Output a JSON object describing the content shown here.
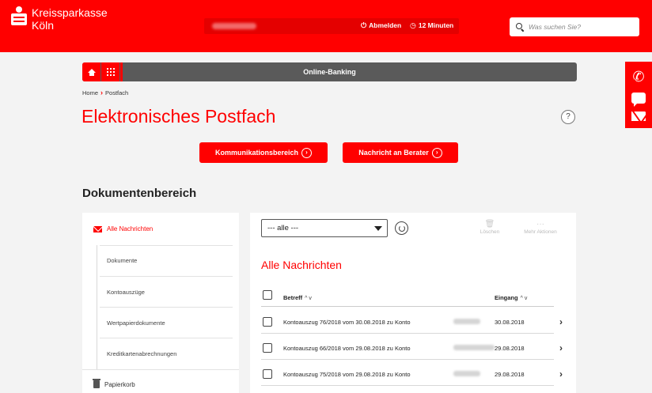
{
  "header": {
    "bank_name_line1": "Kreissparkasse",
    "bank_name_line2": "Köln",
    "logout_label": "Abmelden",
    "timer_label": "12 Minuten",
    "search_placeholder": "Was suchen Sie?"
  },
  "contact_sidebar": {
    "phone_icon": "phone-icon",
    "chat_icon": "chat-bubble-icon",
    "mail_icon": "mail-icon"
  },
  "navbar": {
    "title": "Online-Banking",
    "home_icon": "home-icon",
    "apps_icon": "grid-icon"
  },
  "breadcrumb": {
    "home": "Home",
    "current": "Postfach"
  },
  "page": {
    "title": "Elektronisches Postfach",
    "help_label": "?"
  },
  "buttons": {
    "communication": "Kommunikationsbereich",
    "message_to_advisor": "Nachricht an Berater"
  },
  "section": {
    "title": "Dokumentenbereich"
  },
  "sidebar": {
    "all_messages": "Alle Nachrichten",
    "documents": "Dokumente",
    "statements": "Kontoauszüge",
    "securities": "Wertpapierdokumente",
    "credit_cards": "Kreditkartenabrechnungen",
    "trash": "Papierkorb"
  },
  "main": {
    "filter_value": "--- alle ---",
    "delete_label": "Löschen",
    "more_actions_label": "Mehr Aktionen",
    "list_title": "Alle Nachrichten",
    "col_subject": "Betreff",
    "col_received": "Eingang",
    "sort_icons": "^ v",
    "rows": [
      {
        "subject": "Kontoauszug 76/2018 vom 30.08.2018 zu Konto",
        "date": "30.08.2018"
      },
      {
        "subject": "Kontoauszug 66/2018 vom 29.08.2018 zu Konto",
        "date": "29.08.2018"
      },
      {
        "subject": "Kontoauszug 75/2018 vom 29.08.2018 zu Konto",
        "date": "29.08.2018"
      }
    ]
  },
  "colors": {
    "brand_red": "#ff0000",
    "nav_gray": "#5a5a5a",
    "page_bg": "#f3f3f3"
  }
}
